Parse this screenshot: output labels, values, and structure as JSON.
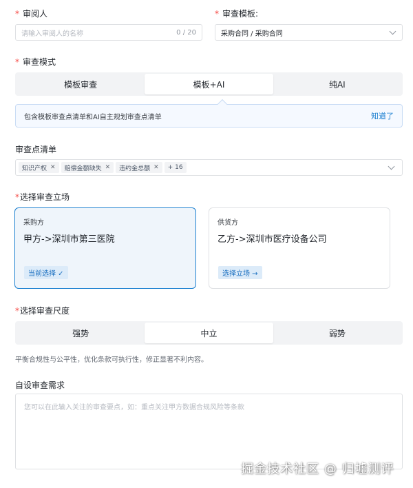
{
  "reviewer": {
    "label": "审阅人",
    "placeholder": "请输入审阅人的名称",
    "counter": "0 / 20"
  },
  "template": {
    "label": "审查模板:",
    "value": "采购合同 / 采购合同"
  },
  "mode": {
    "label": "审查模式",
    "options": [
      "模板审查",
      "模板+AI",
      "纯AI"
    ],
    "selected": "模板+AI"
  },
  "info": {
    "text": "包含模板审查点清单和AI自主规划审查点清单",
    "link": "知道了"
  },
  "checklist": {
    "label": "审查点清单",
    "tags": [
      "知识产权",
      "赔偿金额缺失",
      "违约金总额"
    ],
    "more": "+ 16"
  },
  "stance": {
    "label": "选择审查立场",
    "cards": [
      {
        "role": "采购方",
        "party": "甲方->深圳市第三医院",
        "action": "当前选择 ✓",
        "selected": true
      },
      {
        "role": "供货方",
        "party": "乙方->深圳市医疗设备公司",
        "action": "选择立场 →",
        "selected": false
      }
    ]
  },
  "scale": {
    "label": "选择审查尺度",
    "options": [
      "强势",
      "中立",
      "弱势"
    ],
    "selected": "中立",
    "hint": "平衡合规性与公平性，优化条款可执行性，修正显著不利内容。"
  },
  "custom": {
    "label": "自设审查需求",
    "placeholder": "您可以在此输入关注的审查要点，如：重点关注甲方数据合规风险等条款"
  },
  "watermark": "掘金技术社区 @ 归墟测评",
  "colors": {
    "accent": "#1a7fd0",
    "required": "#f54a45"
  },
  "icons": {
    "dropdown": "chevron-down-icon",
    "tag_remove": "close-icon"
  }
}
